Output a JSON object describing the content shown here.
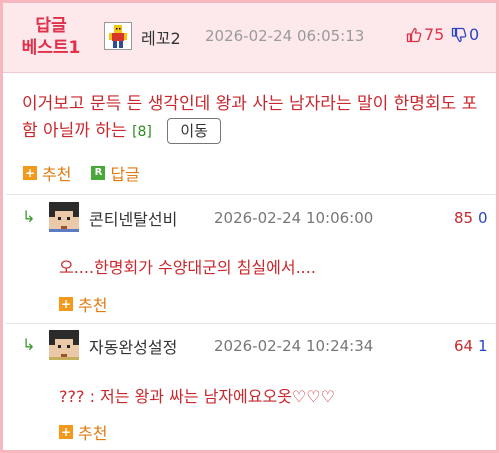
{
  "main_comment": {
    "badge": "답글\n베스트1",
    "badge_line1": "답글",
    "badge_line2": "베스트1",
    "author": "레꼬2",
    "datetime": "2026-02-24 06:05:13",
    "likes": "75",
    "dislikes": "0",
    "text": "이거보고 문득 든 생각인데 왕과 사는 남자라는 말이 한명회도 포함 아닐까 하는",
    "reply_count": "[8]",
    "move_button": "이동",
    "recommend_label": "추천",
    "reply_label": "답글"
  },
  "replies": [
    {
      "arrow": "↳",
      "author": "콘티넨탈선비",
      "datetime": "2026-02-24 10:06:00",
      "likes": "85",
      "dislikes": "0",
      "text": "오....한명회가 수양대군의 침실에서....",
      "recommend_label": "추천"
    },
    {
      "arrow": "↳",
      "author": "자동완성설정",
      "datetime": "2026-02-24 10:24:34",
      "likes": "64",
      "dislikes": "1",
      "text": "??? : 저는 왕과 싸는 남자에요오옷♡♡♡",
      "recommend_label": "추천"
    }
  ],
  "colors": {
    "border": "#f7b7be",
    "header_bg": "#fde9ec",
    "accent_red": "#c8282d",
    "dislike_blue": "#2a46c4",
    "recommend_orange": "#e07b10",
    "reply_green": "#3d9a2c"
  },
  "icons": {
    "thumbs_up": "thumbs-up-icon",
    "thumbs_down": "thumbs-down-icon",
    "plus": "plus-square-icon",
    "reply": "reply-square-icon",
    "reply_arrow": "reply-arrow-icon"
  }
}
